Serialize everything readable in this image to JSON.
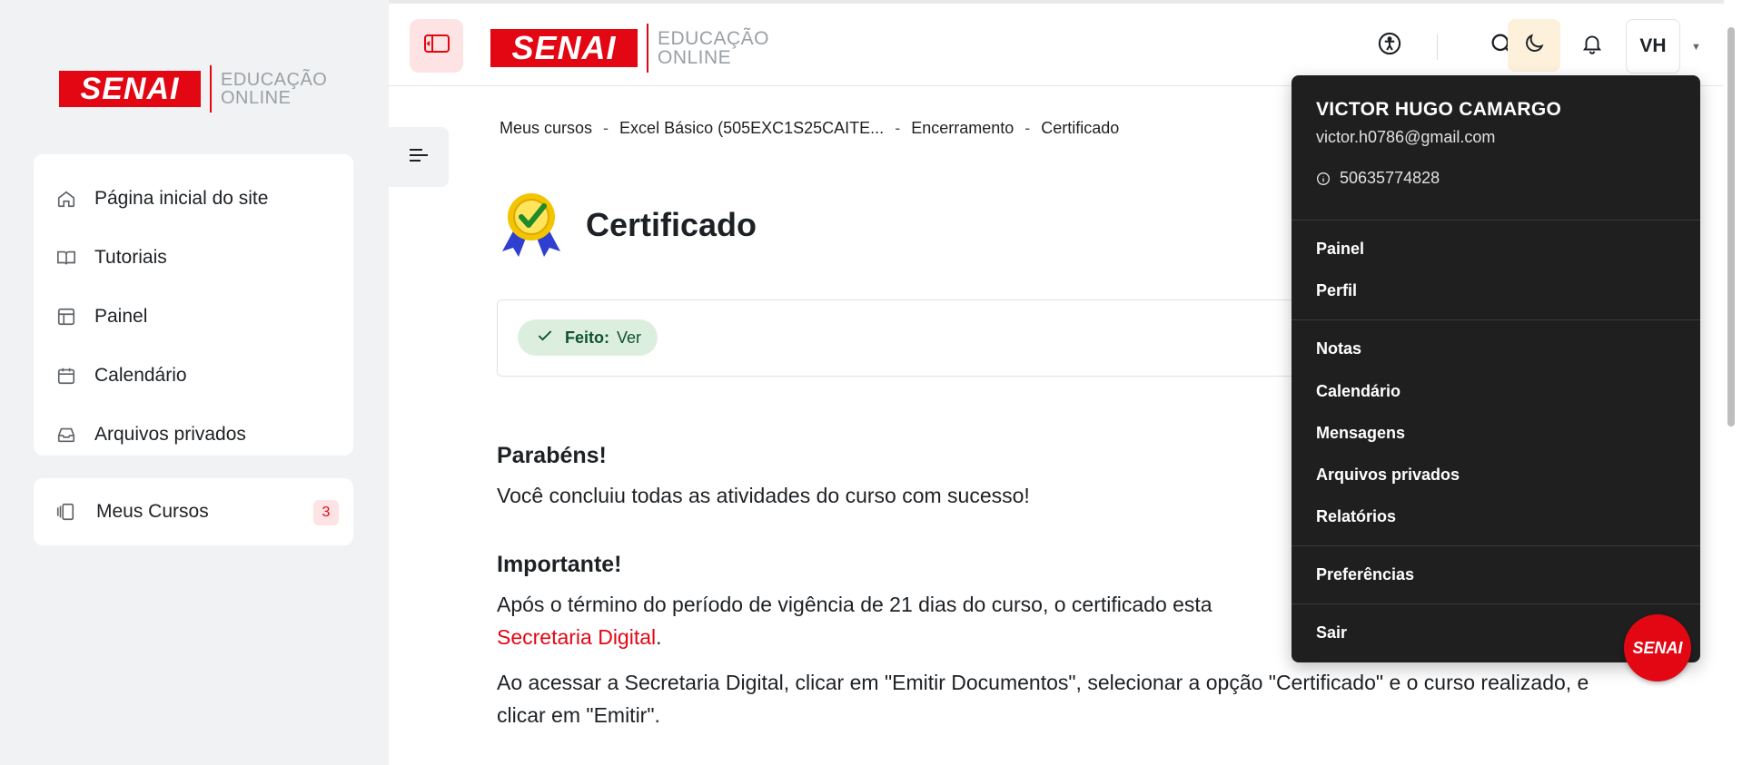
{
  "brand": {
    "name": "SENAI",
    "line1": "EDUCAÇÃO",
    "line2": "ONLINE",
    "accent": "#e30613"
  },
  "sidebar": {
    "items": [
      {
        "label": "Página inicial do site",
        "icon": "home-icon"
      },
      {
        "label": "Tutoriais",
        "icon": "book-icon"
      },
      {
        "label": "Painel",
        "icon": "dashboard-icon"
      },
      {
        "label": "Calendário",
        "icon": "calendar-icon"
      },
      {
        "label": "Arquivos privados",
        "icon": "inbox-icon"
      }
    ],
    "courses": {
      "label": "Meus Cursos",
      "count": "3",
      "icon": "courses-icon"
    }
  },
  "topbar": {
    "avatar_initials": "VH",
    "icons": [
      "sidebar-toggle-icon",
      "accessibility-icon",
      "search-icon",
      "moon-icon",
      "bell-icon",
      "chevron-down-icon"
    ]
  },
  "breadcrumb": [
    "Meus cursos",
    "Excel Básico (505EXC1S25CAITE...",
    "Encerramento",
    "Certificado"
  ],
  "breadcrumb_sep": "-",
  "page": {
    "title": "Certificado",
    "completion": {
      "label": "Feito:",
      "value": "Ver"
    },
    "heading1": "Parabéns!",
    "para1": "Você concluiu todas as atividades do curso com sucesso!",
    "heading2": "Importante!",
    "para2": "Após o término do período de vigência de 21 dias do curso, o certificado esta",
    "para2_link": "Secretaria Digital",
    "para2_end": ".",
    "para3": "Ao acessar a Secretaria Digital, clicar em \"Emitir Documentos\", selecionar a opção \"Certificado\" e o curso realizado, e clicar em \"Emitir\"."
  },
  "user_menu": {
    "name": "VICTOR HUGO CAMARGO",
    "email": "victor.h0786@gmail.com",
    "id": "50635774828",
    "items": [
      "Painel",
      "Perfil",
      "Notas",
      "Calendário",
      "Mensagens",
      "Arquivos privados",
      "Relatórios",
      "Preferências",
      "Sair"
    ]
  },
  "fab": {
    "label": "SENAI"
  }
}
